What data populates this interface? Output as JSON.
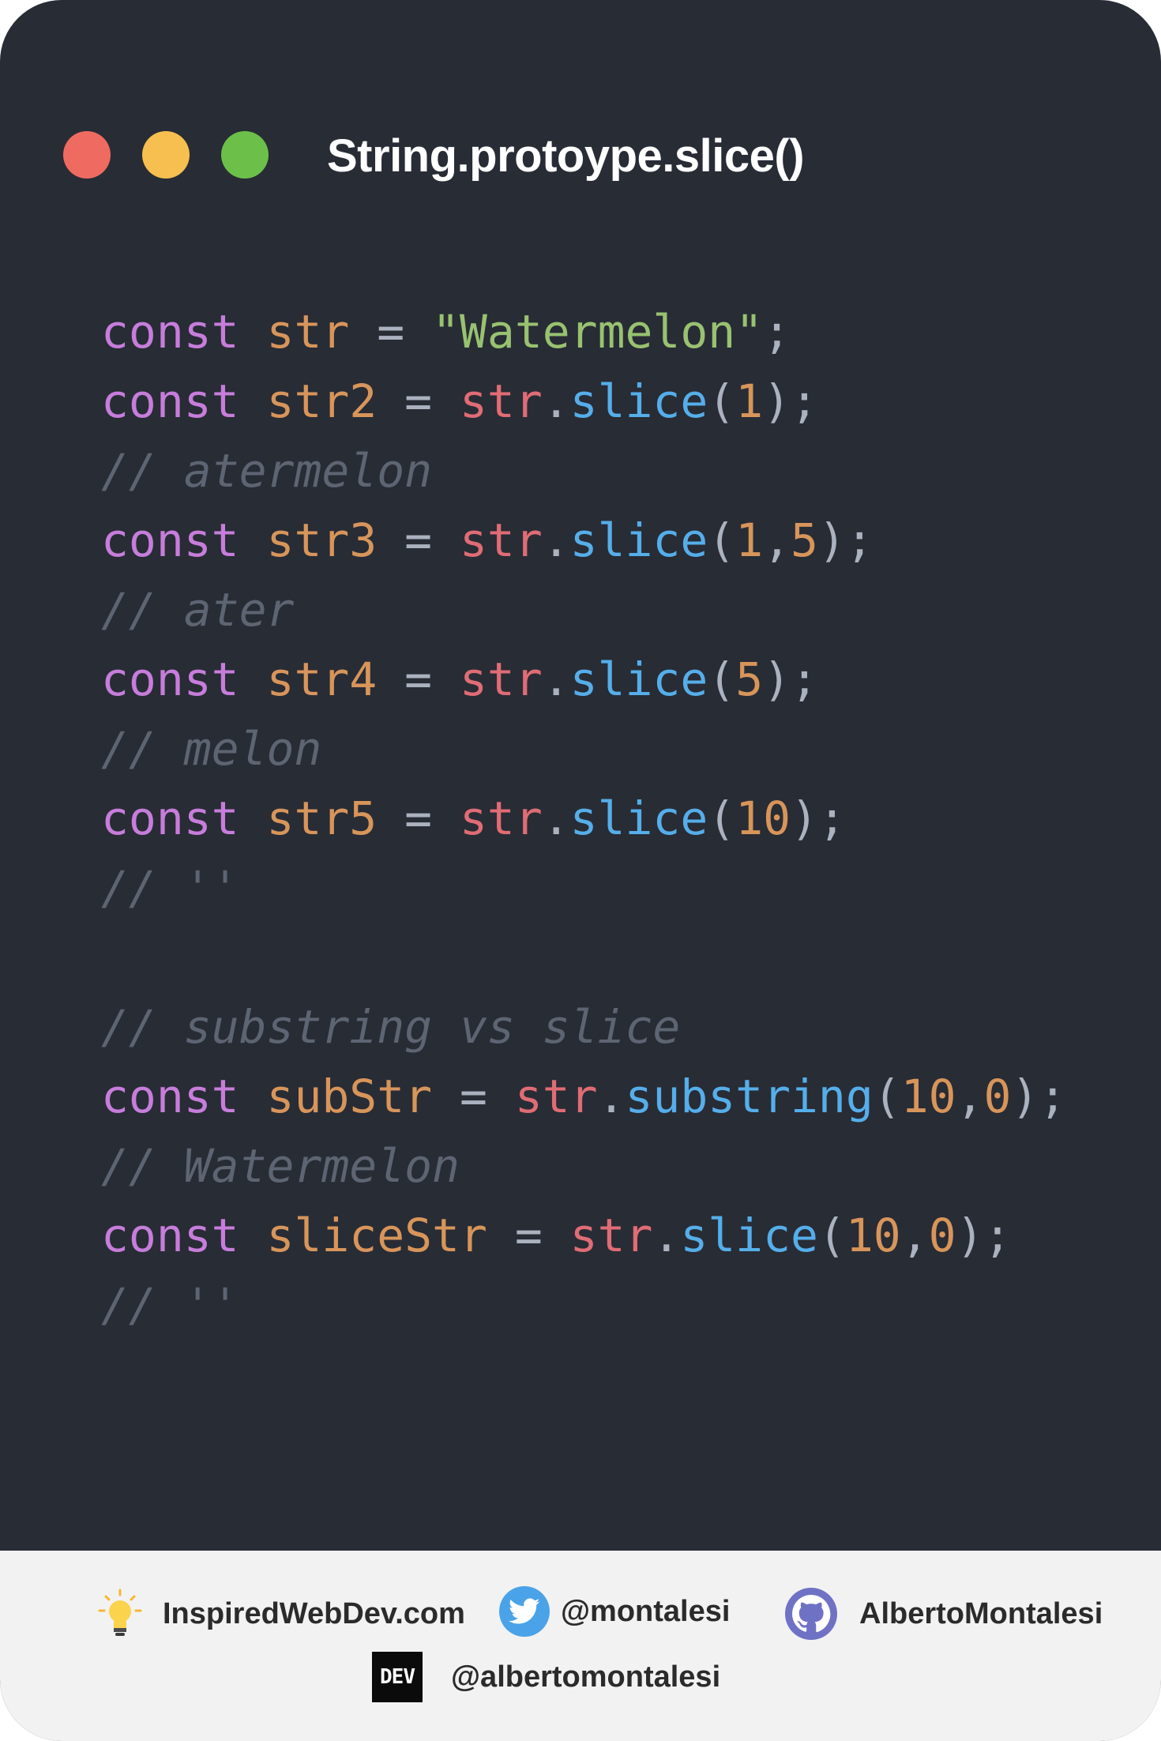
{
  "window": {
    "title": "String.protoype.slice()",
    "dots": [
      "red",
      "yellow",
      "green"
    ]
  },
  "code": {
    "lines": [
      {
        "kw": "const",
        "var": "str",
        "op": "=",
        "str": "\"Watermelon\"",
        "end": ";"
      },
      {
        "kw": "const",
        "var": "str2",
        "op": "=",
        "obj": "str",
        "dot": ".",
        "fn": "slice",
        "open": "(",
        "args": [
          "1"
        ],
        "close": ")",
        "end": ";"
      },
      {
        "comment": "// atermelon"
      },
      {
        "kw": "const",
        "var": "str3",
        "op": "=",
        "obj": "str",
        "dot": ".",
        "fn": "slice",
        "open": "(",
        "args": [
          "1",
          "5"
        ],
        "close": ")",
        "end": ";"
      },
      {
        "comment": "// ater"
      },
      {
        "kw": "const",
        "var": "str4",
        "op": "=",
        "obj": "str",
        "dot": ".",
        "fn": "slice",
        "open": "(",
        "args": [
          "5"
        ],
        "close": ")",
        "end": ";"
      },
      {
        "comment": "// melon"
      },
      {
        "kw": "const",
        "var": "str5",
        "op": "=",
        "obj": "str",
        "dot": ".",
        "fn": "slice",
        "open": "(",
        "args": [
          "10"
        ],
        "close": ")",
        "end": ";"
      },
      {
        "comment": "// ''"
      },
      {
        "blank": true
      },
      {
        "comment": "// substring vs slice"
      },
      {
        "kw": "const",
        "var": "subStr",
        "op": "=",
        "obj": "str",
        "dot": ".",
        "fn": "substring",
        "open": "(",
        "args": [
          "10",
          "0"
        ],
        "close": ")",
        "end": ";"
      },
      {
        "comment": "// Watermelon"
      },
      {
        "kw": "const",
        "var": "sliceStr",
        "op": "=",
        "obj": "str",
        "dot": ".",
        "fn": "slice",
        "open": "(",
        "args": [
          "10",
          "0"
        ],
        "close": ")",
        "end": ";"
      },
      {
        "comment": "// ''"
      }
    ]
  },
  "footer": {
    "website": {
      "icon": "lightbulb-icon",
      "text": "InspiredWebDev.com"
    },
    "twitter": {
      "icon": "twitter-icon",
      "text": "@montalesi"
    },
    "github": {
      "icon": "github-icon",
      "text": "AlbertoMontalesi"
    },
    "dev": {
      "icon": "dev-icon",
      "icon_text": "DEV",
      "text": "@albertomontalesi"
    }
  },
  "colors": {
    "background": "#282c35",
    "keyword": "#c77ddb",
    "variable": "#d8955a",
    "string": "#98c270",
    "object": "#e06c75",
    "function": "#55aeea",
    "comment": "#5d6472",
    "footer_bg": "#f2f2f2"
  }
}
